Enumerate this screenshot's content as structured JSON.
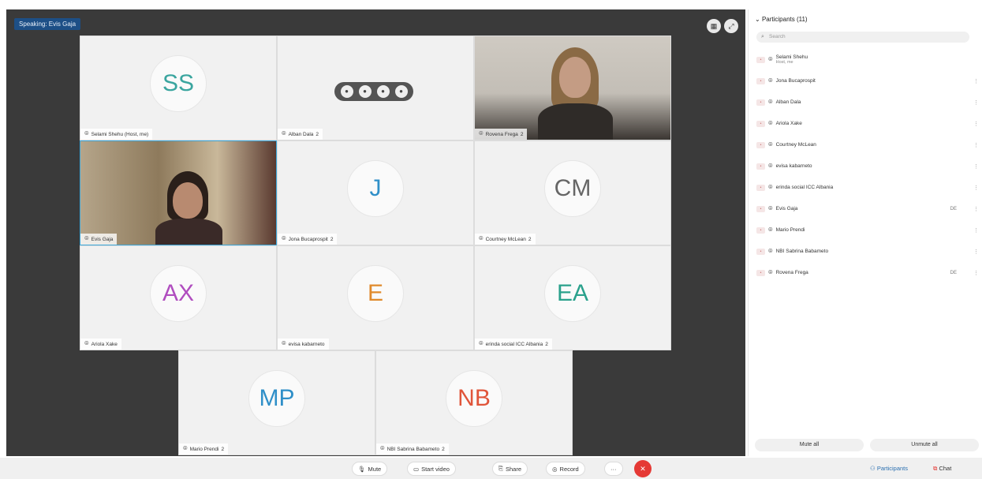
{
  "stage": {
    "speaking_label": "Speaking: Evis Gaja",
    "tiles": [
      {
        "initials": "SS",
        "initials_color": "#3aa59f",
        "name": "Selami Shehu (Host, me)"
      },
      {
        "initials": "",
        "name": "Alban Dala",
        "tag": "2"
      },
      {
        "initials": "",
        "name": "Rovena Frega",
        "tag": "2"
      },
      {
        "initials": "",
        "name": "Evis Gaja"
      },
      {
        "initials": "J",
        "initials_color": "#2f8fc8",
        "name": "Jona Bucaprospit",
        "tag": "2"
      },
      {
        "initials": "CM",
        "initials_color": "#666666",
        "name": "Courtney McLean",
        "tag": "2"
      },
      {
        "initials": "AX",
        "initials_color": "#b04dbf",
        "name": "Ariola Xake"
      },
      {
        "initials": "E",
        "initials_color": "#e08a2c",
        "name": "evisa kabarneto"
      },
      {
        "initials": "EA",
        "initials_color": "#2aa18c",
        "name": "erinda social ICC Albania",
        "tag": "2"
      },
      {
        "initials": "MP",
        "initials_color": "#2f8fc8",
        "name": "Mario Prendi",
        "tag": "2"
      },
      {
        "initials": "NB",
        "initials_color": "#e0553a",
        "name": "NBI Sabrina Babameto",
        "tag": "2"
      }
    ]
  },
  "panel": {
    "title": "Participants (11)",
    "search_placeholder": "Search",
    "participants": [
      {
        "name": "Selami Shehu",
        "sub": "Host, me",
        "tag": "",
        "end": ""
      },
      {
        "name": "Jona Bucaprospit",
        "sub": "",
        "tag": "",
        "end": "⋮"
      },
      {
        "name": "Alban Dala",
        "sub": "",
        "tag": "",
        "end": "⋮"
      },
      {
        "name": "Ariola Xake",
        "sub": "",
        "tag": "",
        "end": "⋮"
      },
      {
        "name": "Courtney McLean",
        "sub": "",
        "tag": "",
        "end": "⋮"
      },
      {
        "name": "evisa kabarneto",
        "sub": "",
        "tag": "",
        "end": "⋮"
      },
      {
        "name": "erinda social ICC Albania",
        "sub": "",
        "tag": "",
        "end": "⋮"
      },
      {
        "name": "Evis Gaja",
        "sub": "",
        "tag": "DE",
        "end": "⋮"
      },
      {
        "name": "Mario Prendi",
        "sub": "",
        "tag": "",
        "end": "⋮"
      },
      {
        "name": "NBI Sabrina Babameto",
        "sub": "",
        "tag": "",
        "end": "⋮"
      },
      {
        "name": "Rovena Frega",
        "sub": "",
        "tag": "DE",
        "end": "⋮"
      }
    ],
    "mute_all": "Mute all",
    "unmute_all": "Unmute all"
  },
  "toolbar": {
    "mute_label": "Mute",
    "video_label": "Start video",
    "share_label": "Share",
    "record_label": "Record",
    "more_label": "···",
    "participants_label": "Participants",
    "chat_label": "Chat"
  }
}
